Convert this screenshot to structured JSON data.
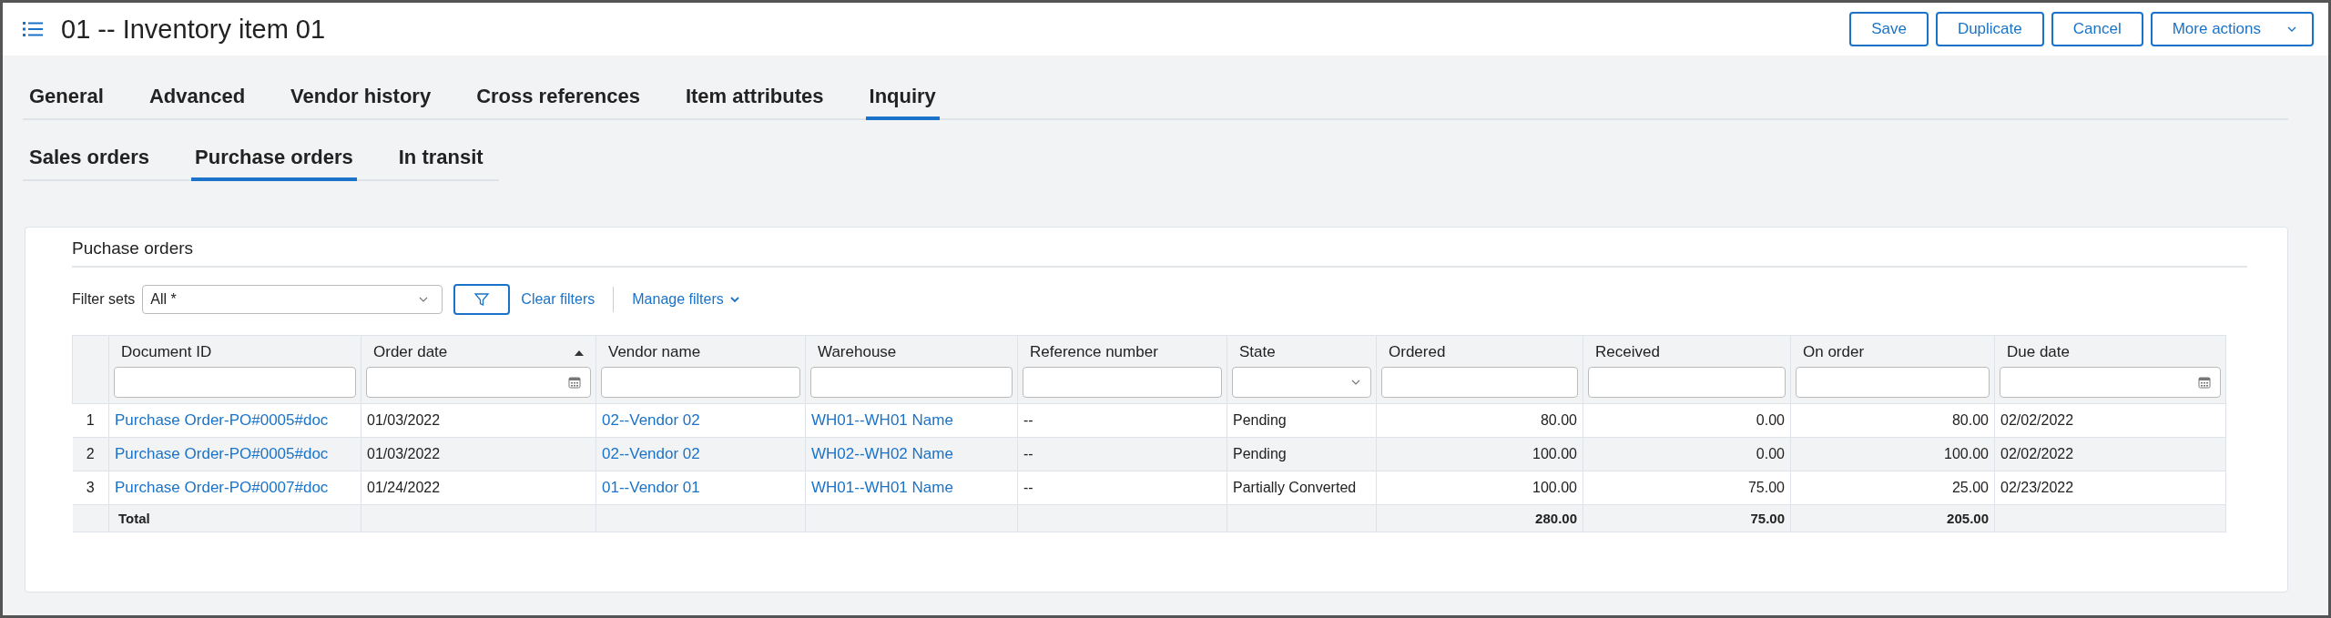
{
  "header": {
    "title": "01 -- Inventory item 01",
    "buttons": [
      {
        "label": "Save",
        "dropdown": false
      },
      {
        "label": "Duplicate",
        "dropdown": false
      },
      {
        "label": "Cancel",
        "dropdown": false
      },
      {
        "label": "More actions",
        "dropdown": true
      }
    ]
  },
  "tabs": [
    {
      "label": "General",
      "selected": false
    },
    {
      "label": "Advanced",
      "selected": false
    },
    {
      "label": "Vendor history",
      "selected": false
    },
    {
      "label": "Cross references",
      "selected": false
    },
    {
      "label": "Item attributes",
      "selected": false
    },
    {
      "label": "Inquiry",
      "selected": true
    }
  ],
  "subtabs": [
    {
      "label": "Sales orders",
      "selected": false
    },
    {
      "label": "Purchase orders",
      "selected": true
    },
    {
      "label": "In transit",
      "selected": false
    }
  ],
  "card": {
    "title": "Puchase orders",
    "filter_sets": {
      "label": "Filter sets",
      "value": "All *"
    },
    "clear_filters": "Clear filters",
    "manage_filters": "Manage filters",
    "table": {
      "columns": [
        {
          "label": "Document ID",
          "date_filter": false,
          "select_filter": false,
          "sorted_ascending": false,
          "kind": "link"
        },
        {
          "label": "Order date",
          "date_filter": true,
          "select_filter": false,
          "sorted_ascending": true,
          "kind": "text"
        },
        {
          "label": "Vendor name",
          "date_filter": false,
          "select_filter": false,
          "sorted_ascending": false,
          "kind": "link"
        },
        {
          "label": "Warehouse",
          "date_filter": false,
          "select_filter": false,
          "sorted_ascending": false,
          "kind": "link"
        },
        {
          "label": "Reference number",
          "date_filter": false,
          "select_filter": false,
          "sorted_ascending": false,
          "kind": "text"
        },
        {
          "label": "State",
          "date_filter": false,
          "select_filter": true,
          "sorted_ascending": false,
          "kind": "text"
        },
        {
          "label": "Ordered",
          "date_filter": false,
          "select_filter": false,
          "sorted_ascending": false,
          "kind": "number",
          "total": "280.00"
        },
        {
          "label": "Received",
          "date_filter": false,
          "select_filter": false,
          "sorted_ascending": false,
          "kind": "number",
          "total": "75.00"
        },
        {
          "label": "On order",
          "date_filter": false,
          "select_filter": false,
          "sorted_ascending": false,
          "kind": "number",
          "total": "205.00"
        },
        {
          "label": "Due date",
          "date_filter": true,
          "select_filter": false,
          "sorted_ascending": false,
          "kind": "text"
        }
      ],
      "rows": [
        {
          "number": "1",
          "cells": [
            "Purchase Order-PO#0005#doc",
            "01/03/2022",
            "02--Vendor 02",
            "WH01--WH01 Name",
            "--",
            "Pending",
            "80.00",
            "0.00",
            "80.00",
            "02/02/2022"
          ]
        },
        {
          "number": "2",
          "cells": [
            "Purchase Order-PO#0005#doc",
            "01/03/2022",
            "02--Vendor 02",
            "WH02--WH02 Name",
            "--",
            "Pending",
            "100.00",
            "0.00",
            "100.00",
            "02/02/2022"
          ]
        },
        {
          "number": "3",
          "cells": [
            "Purchase Order-PO#0007#doc",
            "01/24/2022",
            "01--Vendor 01",
            "WH01--WH01 Name",
            "--",
            "Partially Converted",
            "100.00",
            "75.00",
            "25.00",
            "02/23/2022"
          ]
        }
      ],
      "total_label": "Total"
    }
  }
}
